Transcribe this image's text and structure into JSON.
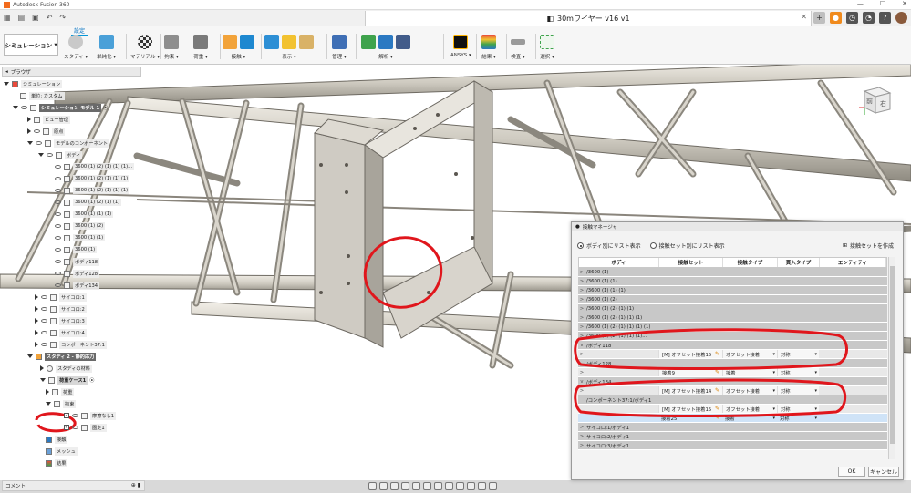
{
  "app": {
    "title": "Autodesk Fusion 360"
  },
  "document": {
    "tab_title": "30mワイヤー v16 v1"
  },
  "toolbar": {
    "workspace": "シミュレーション",
    "active_tab": "設定",
    "tools": [
      "スタディ",
      "単純化",
      "マテリアル",
      "拘束",
      "荷重",
      "接触",
      "表示",
      "管理",
      "解析",
      "ANSYS",
      "結果",
      "検査",
      "選択"
    ]
  },
  "browser": {
    "title": "ブラウザ",
    "rows": [
      {
        "label": "シミュレーション"
      },
      {
        "label": "単位: カスタム"
      },
      {
        "label": "シミュレーション モデル 1"
      },
      {
        "label": "ビュー管理"
      },
      {
        "label": "原点"
      },
      {
        "label": "モデルのコンポーネント"
      },
      {
        "label": "ボディ"
      },
      {
        "label": "3600 (1) (2) (1) (1) (1)..."
      },
      {
        "label": "3600 (1) (2) (1) (1) (1)"
      },
      {
        "label": "3600 (1) (2) (1) (1) (1)"
      },
      {
        "label": "3600 (1) (2) (1) (1)"
      },
      {
        "label": "3600 (1) (1) (1)"
      },
      {
        "label": "3600 (1) (2)"
      },
      {
        "label": "3600 (1) (1)"
      },
      {
        "label": "3600 (1)"
      },
      {
        "label": "ボディ118"
      },
      {
        "label": "ボディ128"
      },
      {
        "label": "ボディ134"
      },
      {
        "label": "サイコロ:1"
      },
      {
        "label": "サイコロ:2"
      },
      {
        "label": "サイコロ:3"
      },
      {
        "label": "サイコロ:4"
      },
      {
        "label": "コンポーネント37:1"
      },
      {
        "label": "スタディ 2 - 静的応力"
      },
      {
        "label": "スタディの材料"
      },
      {
        "label": "荷重ケース1"
      },
      {
        "label": "荷重"
      },
      {
        "label": "拘束"
      },
      {
        "label": "摩擦なし1"
      },
      {
        "label": "固定1"
      },
      {
        "label": "接触"
      },
      {
        "label": "メッシュ"
      },
      {
        "label": "結果"
      }
    ]
  },
  "comments": {
    "label": "コメント"
  },
  "viewcube": {
    "front": "前",
    "right": "右"
  },
  "dialog": {
    "title": "接触マネージャ",
    "radio_by_body": "ボディ別にリスト表示",
    "radio_by_set": "接触セット別にリスト表示",
    "create_set": "接触セットを作成",
    "columns": [
      "ボディ",
      "接触セット",
      "接触タイプ",
      "貫入タイプ",
      "エンティティ"
    ],
    "rows": [
      {
        "kind": "grp",
        "arrow": ">",
        "body": "/3600 (1)"
      },
      {
        "kind": "grp",
        "arrow": ">",
        "body": "/3600 (1) (1)"
      },
      {
        "kind": "grp",
        "arrow": ">",
        "body": "/3600 (1) (1) (1)"
      },
      {
        "kind": "grp",
        "arrow": ">",
        "body": "/3600 (1) (2)"
      },
      {
        "kind": "grp",
        "arrow": ">",
        "body": "/3600 (1) (2) (1) (1)"
      },
      {
        "kind": "grp",
        "arrow": ">",
        "body": "/3600 (1) (2) (1) (1) (1)"
      },
      {
        "kind": "grp",
        "arrow": ">",
        "body": "/3600 (1) (2) (1) (1) (1) (1)"
      },
      {
        "kind": "grp",
        "arrow": ">",
        "body": "/3600 (1) (2) (1) (1) (1)..."
      },
      {
        "kind": "grp",
        "arrow": "v",
        "body": "/ボディ118"
      },
      {
        "kind": "child",
        "arrow": ">",
        "body": "",
        "set": "[M] オフセット接着15",
        "type": "オフセット接着",
        "pen": "対称"
      },
      {
        "kind": "grp",
        "arrow": "",
        "body": "/ボディ128"
      },
      {
        "kind": "child",
        "arrow": ">",
        "body": "",
        "set": "接着9",
        "type": "接着",
        "pen": "対称"
      },
      {
        "kind": "grp",
        "arrow": "v",
        "body": "/ボディ134"
      },
      {
        "kind": "child",
        "arrow": ">",
        "body": "",
        "set": "[M] オフセット接着14",
        "type": "オフセット接着",
        "pen": "対称"
      },
      {
        "kind": "grp",
        "arrow": "",
        "body": "/コンポーネント37:1/ボディ1"
      },
      {
        "kind": "child",
        "arrow": "",
        "body": "",
        "set": "[M] オフセット接着15",
        "type": "オフセット接着",
        "pen": "対称"
      },
      {
        "kind": "hl",
        "arrow": "",
        "body": "",
        "set": "接着25",
        "type": "接着",
        "pen": "対称"
      },
      {
        "kind": "grp",
        "arrow": ">",
        "body": "サイコロ:1/ボディ1"
      },
      {
        "kind": "grp",
        "arrow": ">",
        "body": "サイコロ:2/ボディ1"
      },
      {
        "kind": "grp",
        "arrow": ">",
        "body": "サイコロ:3/ボディ1"
      }
    ],
    "ok": "OK",
    "cancel": "キャンセル"
  },
  "colors": {
    "annotation": "#e0161c",
    "accent": "#0696d7"
  }
}
